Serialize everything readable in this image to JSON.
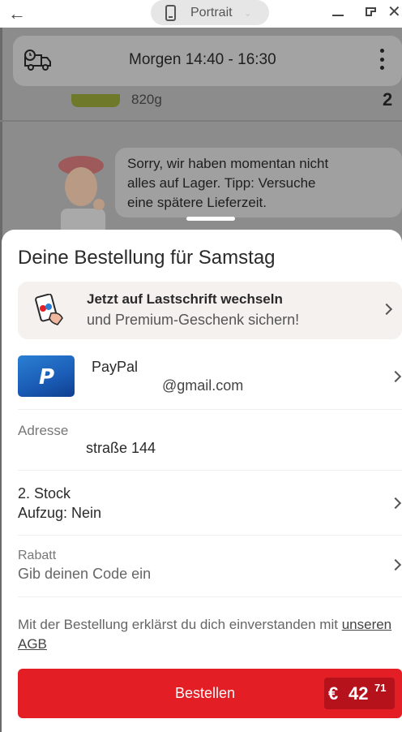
{
  "emulator": {
    "orientation_label": "Portrait",
    "icons": [
      "back-arrow-icon",
      "phone-icon",
      "chevron-down-icon",
      "minimize-icon",
      "restore-icon",
      "close-icon"
    ]
  },
  "background_app": {
    "delivery_time": "Morgen 14:40 - 16:30",
    "product_weight": "820g",
    "product_price_partial": "2",
    "bubble_lines": [
      "Sorry, wir haben momentan nicht",
      "alles auf Lager. Tipp: Versuche",
      "eine spätere Lieferzeit."
    ],
    "icons": [
      "delivery-truck-icon",
      "more-vertical-icon"
    ]
  },
  "sheet": {
    "title": "Deine Bestellung für Samstag",
    "promo": {
      "title": "Jetzt auf Lastschrift wechseln",
      "subtitle": "und Premium-Geschenk sichern!",
      "icon": "cards-gift-icon"
    },
    "payment": {
      "method": "PayPal",
      "email": "@gmail.com",
      "icon": "paypal-logo-icon"
    },
    "address": {
      "label": "Adresse",
      "value": "straße 144"
    },
    "floor": {
      "line1": "2. Stock",
      "line2": "Aufzug: Nein"
    },
    "discount": {
      "label": "Rabatt",
      "hint": "Gib deinen Code ein"
    },
    "agb": {
      "text": "Mit der Bestellung erklärst du dich einverstanden mit",
      "link": "unseren AGB"
    },
    "order_button": {
      "label": "Bestellen",
      "currency": "€",
      "price_whole": "42",
      "price_cents": "71"
    }
  },
  "colors": {
    "brand_red": "#e31e24",
    "price_box": "#b5121b",
    "promo_bg": "#f5f1ee",
    "overlay": "#8c8c8c"
  }
}
